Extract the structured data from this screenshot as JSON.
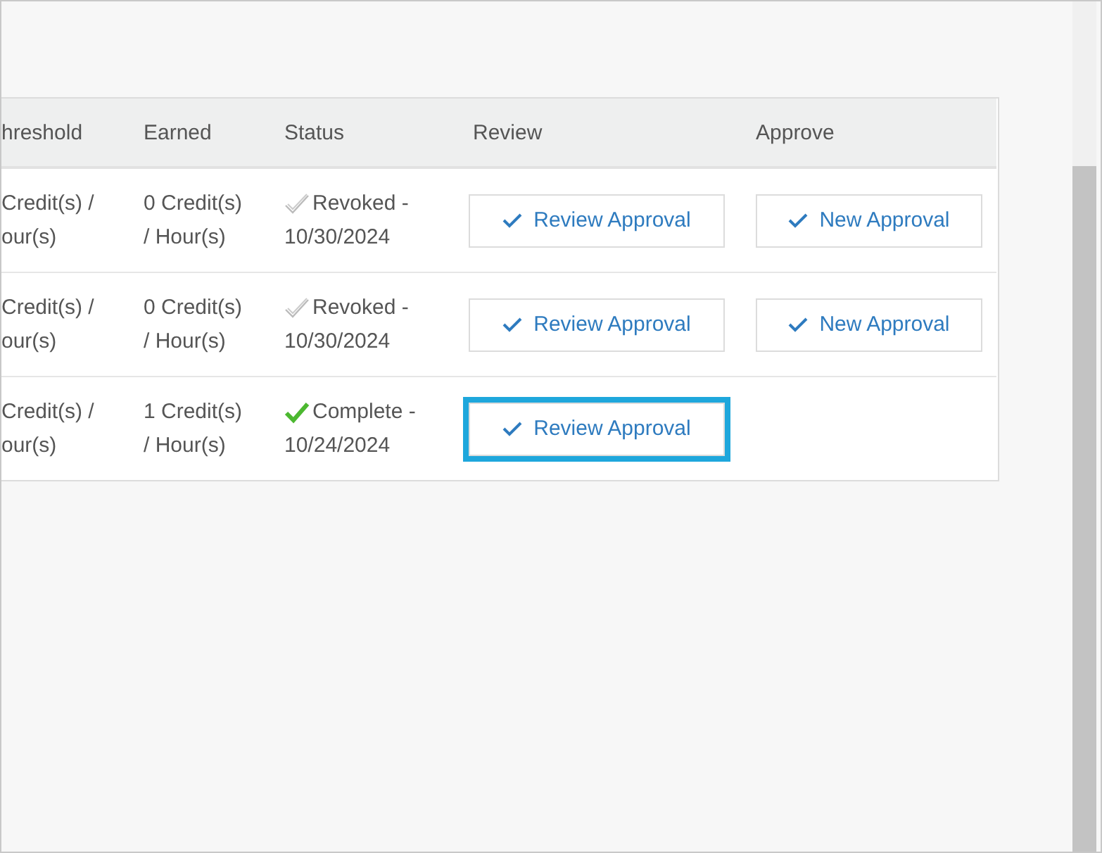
{
  "table": {
    "columns": [
      "hreshold",
      "Earned",
      "Status",
      "Review",
      "Approve"
    ],
    "rows": [
      {
        "threshold": [
          "Credit(s) /",
          "our(s)"
        ],
        "earned": [
          "0 Credit(s)",
          "/ Hour(s)"
        ],
        "status": {
          "kind": "revoked",
          "label": "Revoked -",
          "date": "10/30/2024"
        },
        "review": {
          "label": "Review Approval",
          "highlighted": false
        },
        "approve": {
          "label": "New Approval"
        }
      },
      {
        "threshold": [
          "Credit(s) /",
          "our(s)"
        ],
        "earned": [
          "0 Credit(s)",
          "/ Hour(s)"
        ],
        "status": {
          "kind": "revoked",
          "label": "Revoked -",
          "date": "10/30/2024"
        },
        "review": {
          "label": "Review Approval",
          "highlighted": false
        },
        "approve": {
          "label": "New Approval"
        }
      },
      {
        "threshold": [
          "Credit(s) /",
          "our(s)"
        ],
        "earned": [
          "1 Credit(s)",
          "/ Hour(s)"
        ],
        "status": {
          "kind": "complete",
          "label": "Complete -",
          "date": "10/24/2024"
        },
        "review": {
          "label": "Review Approval",
          "highlighted": true
        }
      }
    ]
  }
}
